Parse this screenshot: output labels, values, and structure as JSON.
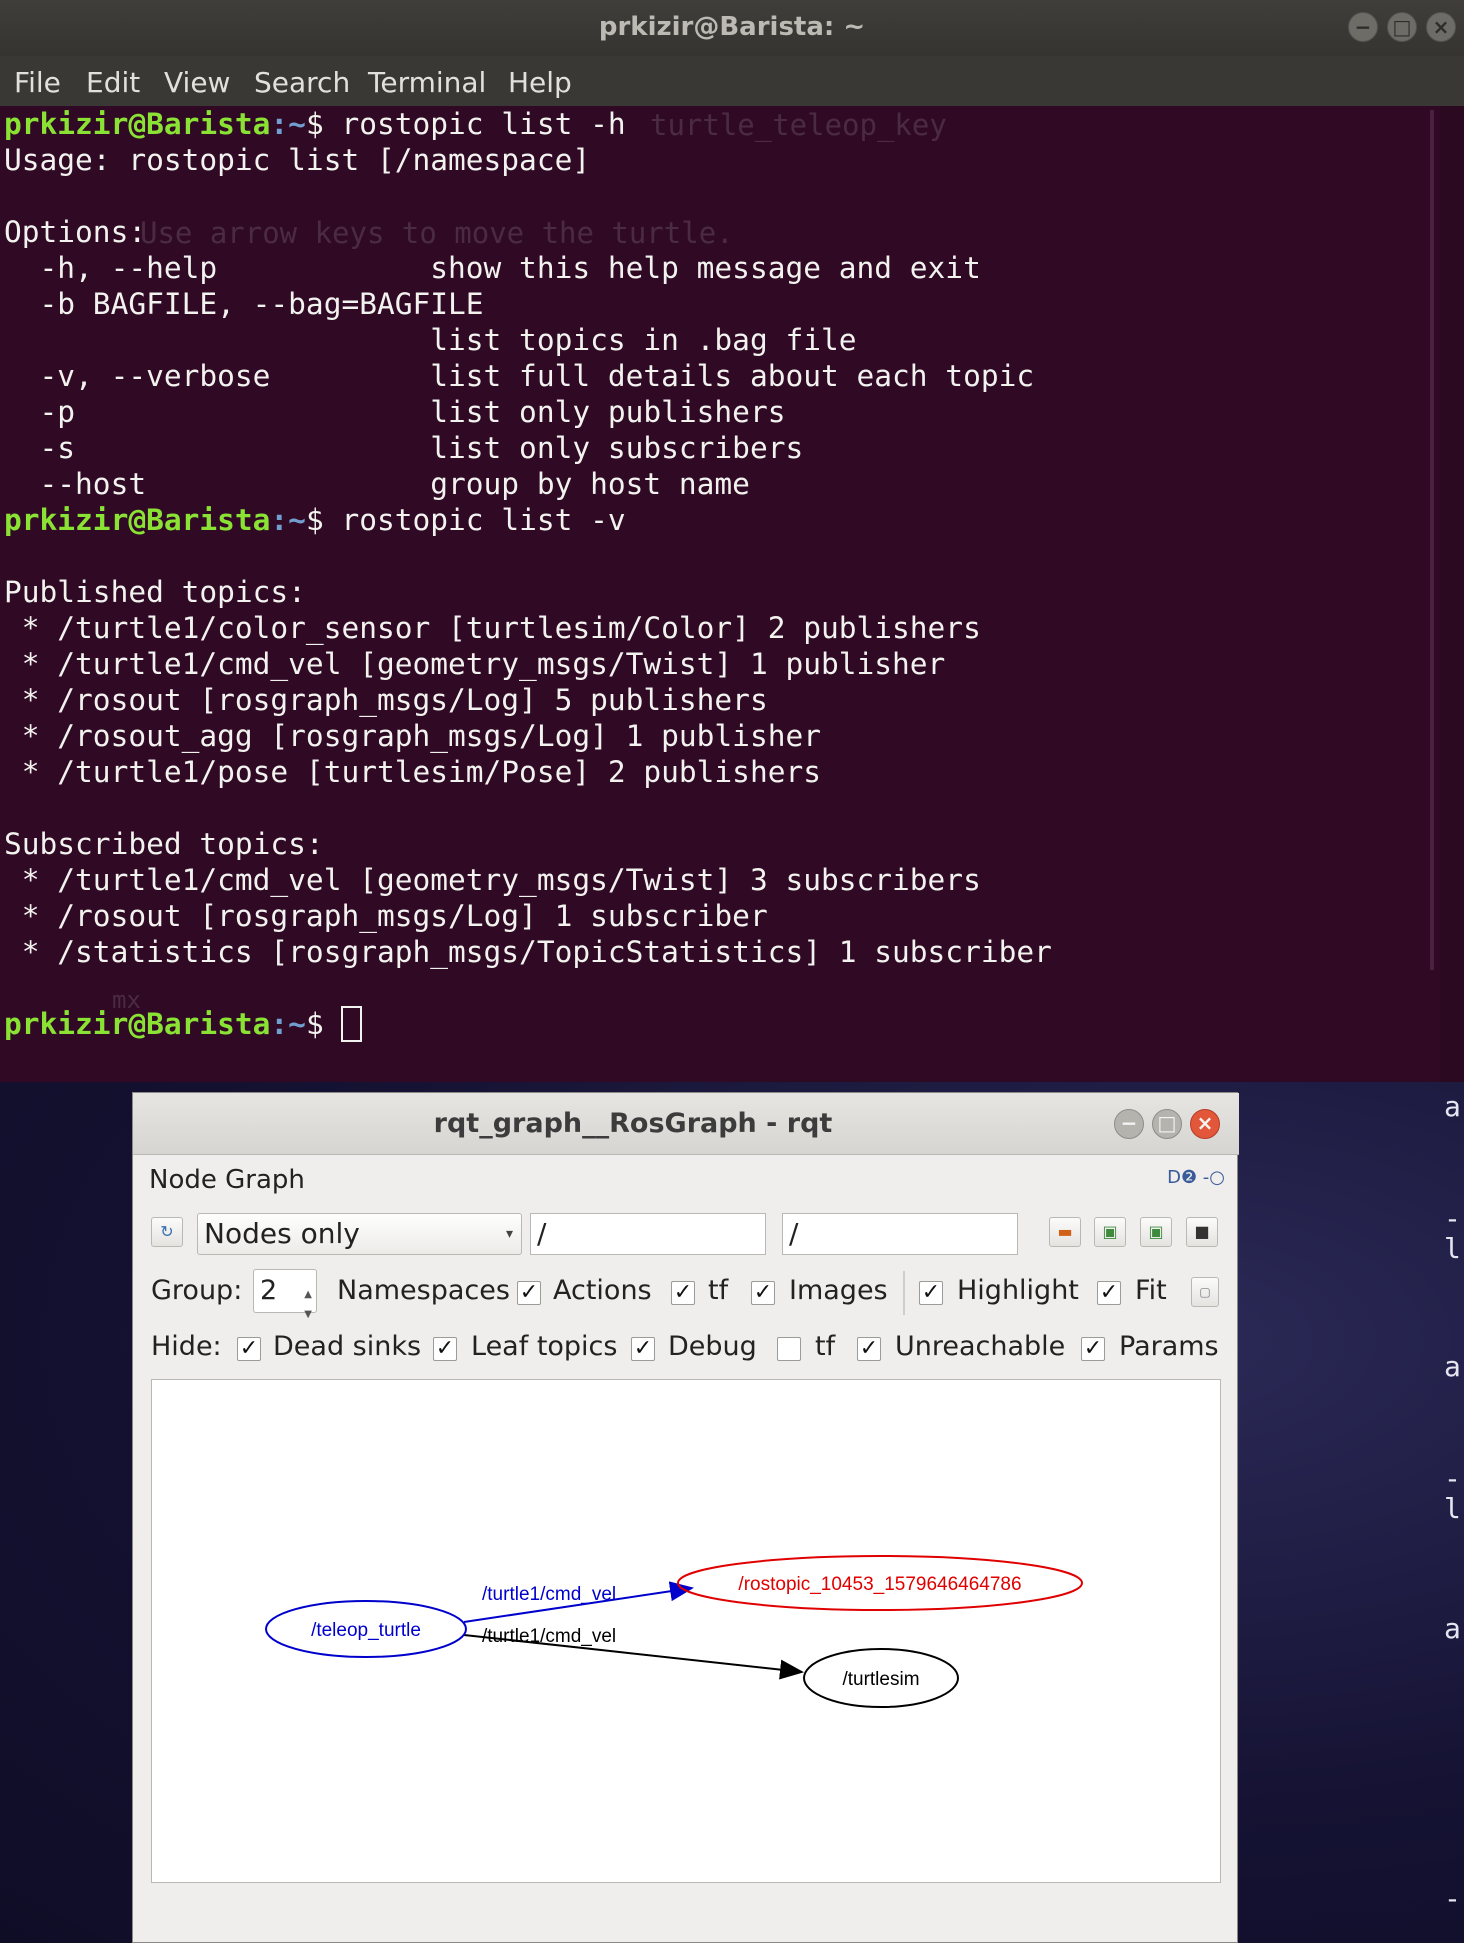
{
  "terminal": {
    "title": "prkizir@Barista: ~",
    "menu": [
      "File",
      "Edit",
      "View",
      "Search",
      "Terminal",
      "Help"
    ],
    "prompt_user": "prkizir@Barista",
    "prompt_path": ":~",
    "prompt_symbol": "$ ",
    "cmd1": "rostopic list -h",
    "cmd2": "rostopic list -v",
    "lines_help": [
      "Usage: rostopic list [/namespace]",
      "",
      "Options:",
      "  -h, --help            show this help message and exit",
      "  -b BAGFILE, --bag=BAGFILE",
      "                        list topics in .bag file",
      "  -v, --verbose         list full details about each topic",
      "  -p                    list only publishers",
      "  -s                    list only subscribers",
      "  --host                group by host name"
    ],
    "lines_verbose": [
      "",
      "Published topics:",
      " * /turtle1/color_sensor [turtlesim/Color] 2 publishers",
      " * /turtle1/cmd_vel [geometry_msgs/Twist] 1 publisher",
      " * /rosout [rosgraph_msgs/Log] 5 publishers",
      " * /rosout_agg [rosgraph_msgs/Log] 1 publisher",
      " * /turtle1/pose [turtlesim/Pose] 2 publishers",
      "",
      "Subscribed topics:",
      " * /turtle1/cmd_vel [geometry_msgs/Twist] 3 subscribers",
      " * /rosout [rosgraph_msgs/Log] 1 subscriber",
      " * /statistics [rosgraph_msgs/TopicStatistics] 1 subscriber",
      ""
    ],
    "ghost_text": [
      "turtle_teleop_key",
      "Use arrow keys to move the turtle.",
      "mx"
    ]
  },
  "desktop": {
    "side_glyphs": [
      "a",
      "-",
      "l",
      "a",
      "-",
      "l",
      "a",
      "-"
    ]
  },
  "rqt": {
    "title": "rqt_graph__RosGraph - rqt",
    "plugin_title": "Node Graph",
    "plugin_icons": "D❷ -○",
    "layout_option": "Nodes only",
    "ns_filter": "/",
    "topic_filter": "/",
    "group_label": "Group:",
    "group_value": "2",
    "options": {
      "namespaces": {
        "label": "Namespaces",
        "checked": true
      },
      "actions": {
        "label": "Actions",
        "checked": true
      },
      "tf": {
        "label": "tf",
        "checked": true
      },
      "images": {
        "label": "Images",
        "checked": true
      },
      "highlight": {
        "label": "Highlight",
        "checked": true
      },
      "fit": {
        "label": "Fit",
        "checked": true
      }
    },
    "hide_label": "Hide:",
    "hide": {
      "dead_sinks": {
        "label": "Dead sinks",
        "checked": true
      },
      "leaf_topics": {
        "label": "Leaf topics",
        "checked": true
      },
      "debug": {
        "label": "Debug",
        "checked": true
      },
      "tf": {
        "label": "tf",
        "checked": false
      },
      "unreachable": {
        "label": "Unreachable",
        "checked": true
      },
      "params": {
        "label": "Params",
        "checked": true
      }
    },
    "graph": {
      "nodes": {
        "teleop": "/teleop_turtle",
        "rostopic": "/rostopic_10453_1579646464786",
        "turtlesim": "/turtlesim"
      },
      "edges": {
        "to_rostopic": "/turtle1/cmd_vel",
        "to_turtlesim": "/turtle1/cmd_vel"
      },
      "colors": {
        "highlight_source": "#0000cc",
        "highlight_target": "#e00000",
        "default": "#000000"
      }
    }
  }
}
